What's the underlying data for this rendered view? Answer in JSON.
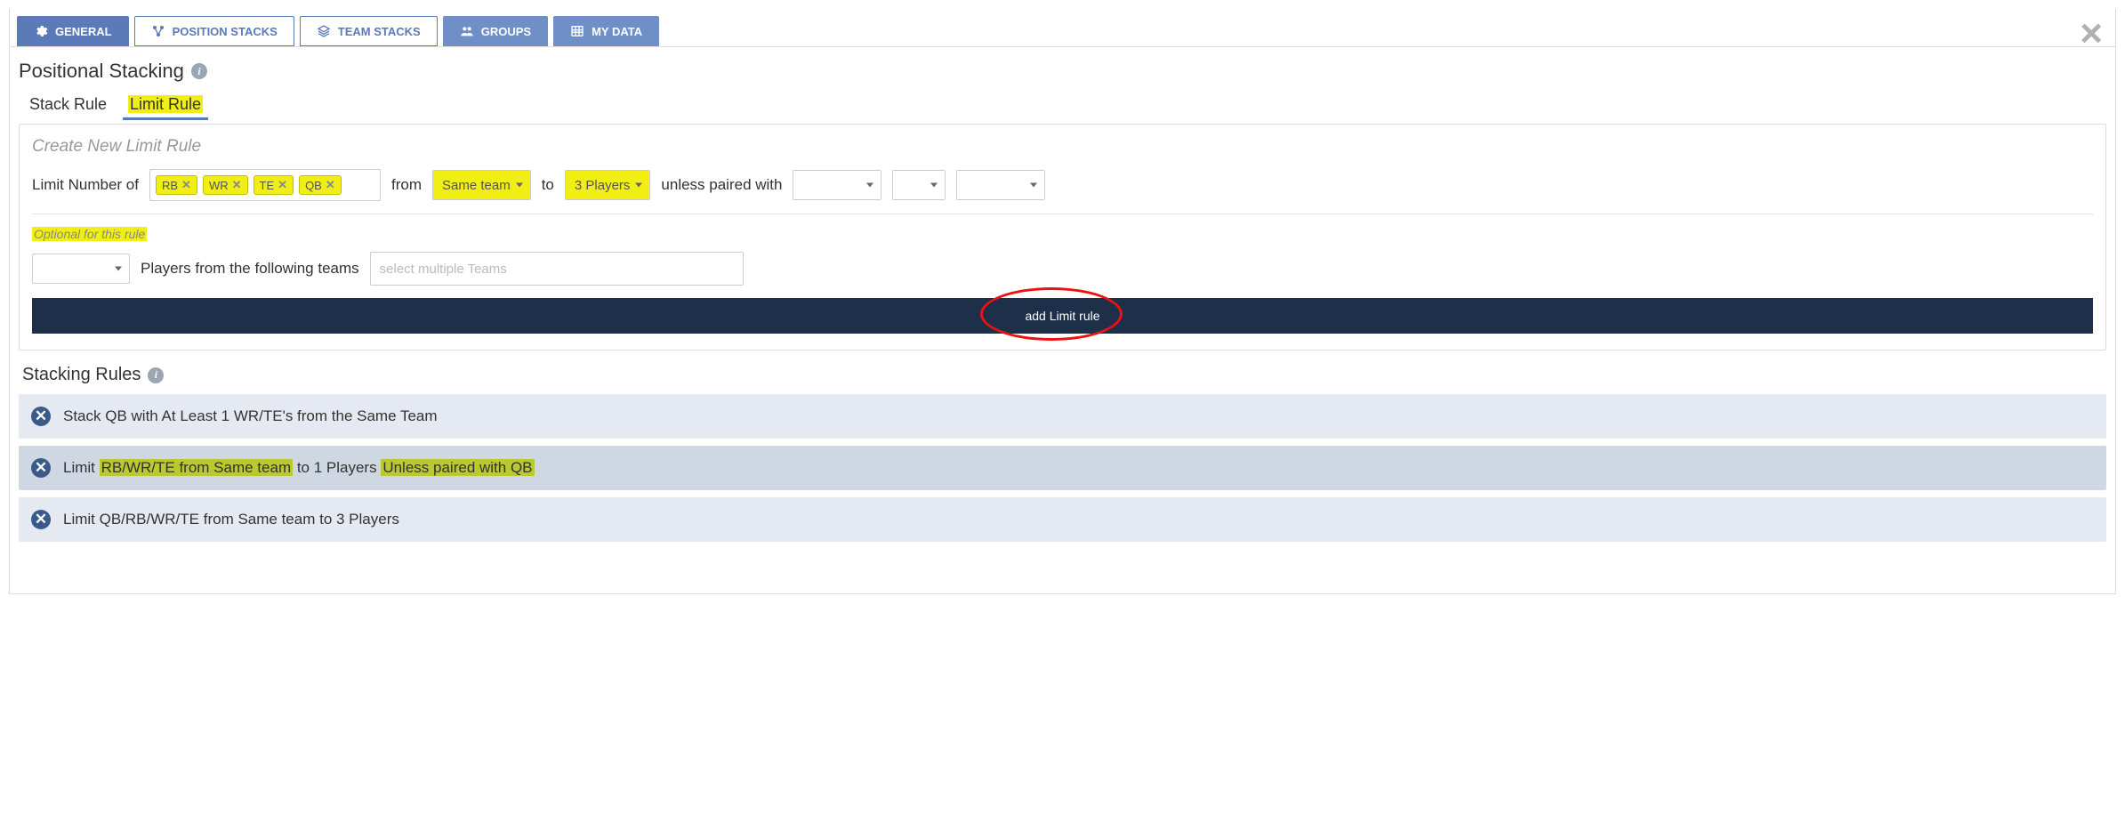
{
  "tabs": {
    "general": "GENERAL",
    "position_stacks": "POSITION STACKS",
    "team_stacks": "TEAM STACKS",
    "groups": "GROUPS",
    "my_data": "MY DATA"
  },
  "section_title": "Positional Stacking",
  "subtabs": {
    "stack_rule": "Stack Rule",
    "limit_rule": "Limit Rule"
  },
  "panel_title": "Create New Limit Rule",
  "form": {
    "limit_label": "Limit Number of",
    "tags": [
      "RB",
      "WR",
      "TE",
      "QB"
    ],
    "from_label": "from",
    "from_value": "Same team",
    "to_label": "to",
    "to_value": "3 Players",
    "unless_label": "unless paired with",
    "optional_note": "Optional for this rule",
    "players_from_label": "Players from the following teams",
    "teams_placeholder": "select multiple Teams",
    "add_button": "add Limit rule"
  },
  "rules_title": "Stacking Rules",
  "rules": [
    {
      "pre": "Stack QB with At Least 1 WR/TE's from the Same Team",
      "h1": "",
      "mid": "",
      "h2": "",
      "post": ""
    },
    {
      "pre": "Limit ",
      "h1": "RB/WR/TE from Same team",
      "mid": " to 1 Players ",
      "h2": "Unless paired with QB",
      "post": ""
    },
    {
      "pre": "Limit QB/RB/WR/TE from Same team to 3 Players",
      "h1": "",
      "mid": "",
      "h2": "",
      "post": ""
    }
  ]
}
